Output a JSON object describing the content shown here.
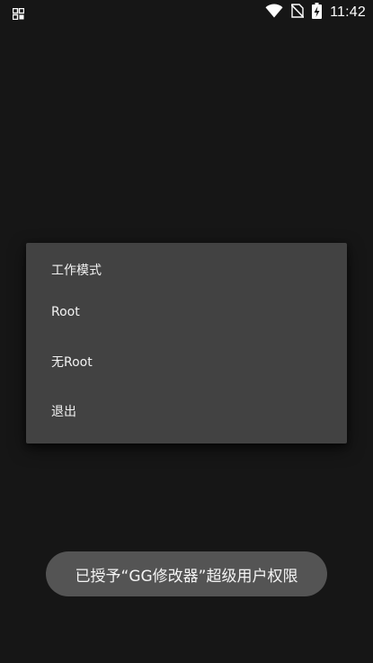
{
  "status_bar": {
    "time": "11:42",
    "left_icon": "app-grid-icon",
    "icons": [
      "wifi-icon",
      "no-sim-icon",
      "battery-charging-icon"
    ]
  },
  "dialog": {
    "title": "工作模式",
    "items": [
      {
        "label": "Root"
      },
      {
        "label": "无Root"
      },
      {
        "label": "退出"
      }
    ]
  },
  "toast": {
    "text": "已授予“GG修改器”超级用户权限"
  },
  "colors": {
    "background": "#161616",
    "dialog_background": "#424242",
    "toast_background": "#545454",
    "text": "#ffffff"
  }
}
